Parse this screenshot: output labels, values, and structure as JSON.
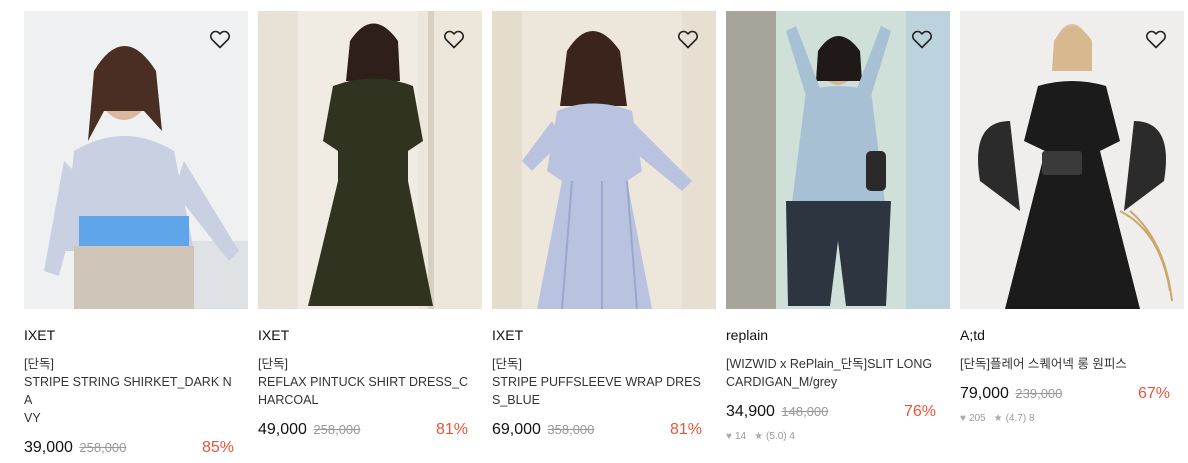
{
  "products": [
    {
      "brand": "IXET",
      "tag": "[단독]",
      "title_line1": "STRIPE STRING SHIRKET_DARK NA",
      "title_line2": "VY",
      "price": "39,000",
      "original_price": "258,000",
      "discount": "85%",
      "likes": "",
      "rating": "",
      "reviews": ""
    },
    {
      "brand": "IXET",
      "tag": "[단독]",
      "title_line1": "REFLAX PINTUCK SHIRT DRESS_C",
      "title_line2": "HARCOAL",
      "price": "49,000",
      "original_price": "258,000",
      "discount": "81%",
      "likes": "",
      "rating": "",
      "reviews": ""
    },
    {
      "brand": "IXET",
      "tag": "[단독]",
      "title_line1": "STRIPE PUFFSLEEVE WRAP DRES",
      "title_line2": "S_BLUE",
      "price": "69,000",
      "original_price": "358,000",
      "discount": "81%",
      "likes": "",
      "rating": "",
      "reviews": ""
    },
    {
      "brand": "replain",
      "tag": "",
      "title_line1": "[WIZWID x RePlain_단독]SLIT LONG",
      "title_line2": "CARDIGAN_M/grey",
      "price": "34,900",
      "original_price": "148,000",
      "discount": "76%",
      "likes": "14",
      "rating": "(5.0)",
      "reviews": "4"
    },
    {
      "brand": "A;td",
      "tag": "",
      "title_line1": "[단독]플레어 스퀘어넥 롱 원피스",
      "title_line2": "",
      "price": "79,000",
      "original_price": "239,000",
      "discount": "67%",
      "likes": "205",
      "rating": "(4.7)",
      "reviews": "8"
    }
  ],
  "icons": {
    "wishlist": "heart-outline-icon",
    "likes": "heart-icon",
    "rating": "star-icon"
  },
  "colors": {
    "discount": "#e8543a",
    "original_price": "#999999"
  }
}
